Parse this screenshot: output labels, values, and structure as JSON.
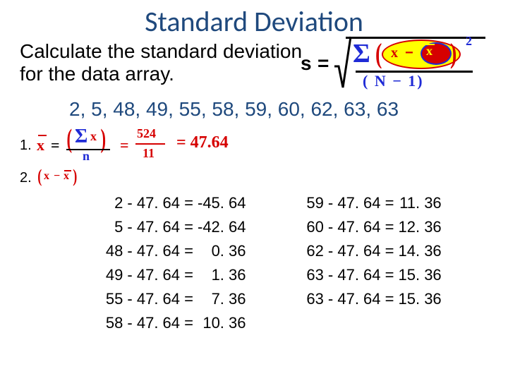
{
  "title": "Standard Deviation",
  "subtitle": "Calculate the standard deviation for the data array.",
  "data_array": "2, 5, 48, 49, 55, 58, 59, 60, 62, 63, 63",
  "formula": {
    "s": "s",
    "eq": "=",
    "sigma": "Σ",
    "paren_open": "(",
    "paren_close": ")",
    "x": "x",
    "minus": "−",
    "xbar": "x",
    "sq": "2",
    "denom": "( N − 1)"
  },
  "step1": {
    "num": "1.",
    "xbar": "x",
    "eq": "=",
    "sigma": "Σ",
    "x": "x",
    "paren_open": "(",
    "paren_close": ")",
    "n": "n",
    "numerator": "524",
    "denominator": "11",
    "result": "= 47.64"
  },
  "step2": {
    "num": "2.",
    "paren_open": "(",
    "x": "x",
    "minus": "−",
    "xbar": "x",
    "paren_close": ")"
  },
  "calcs": {
    "left": [
      {
        "lhs": "2 - 47. 64 =",
        "res": "-45. 64"
      },
      {
        "lhs": "5 - 47. 64 =",
        "res": "-42. 64"
      },
      {
        "lhs": "48 - 47. 64 =",
        "res": "0. 36"
      },
      {
        "lhs": "49 - 47. 64 =",
        "res": "1. 36"
      },
      {
        "lhs": "55 - 47. 64 =",
        "res": "7. 36"
      },
      {
        "lhs": "58 - 47. 64 =",
        "res": "10. 36"
      }
    ],
    "right": [
      {
        "lhs": "59 - 47. 64 =",
        "res": "11. 36"
      },
      {
        "lhs": "60 - 47. 64 =",
        "res": "12. 36"
      },
      {
        "lhs": "62 - 47. 64 =",
        "res": "14. 36"
      },
      {
        "lhs": "63 - 47. 64 =",
        "res": "15. 36"
      },
      {
        "lhs": "63 - 47. 64 =",
        "res": "15. 36"
      }
    ]
  }
}
